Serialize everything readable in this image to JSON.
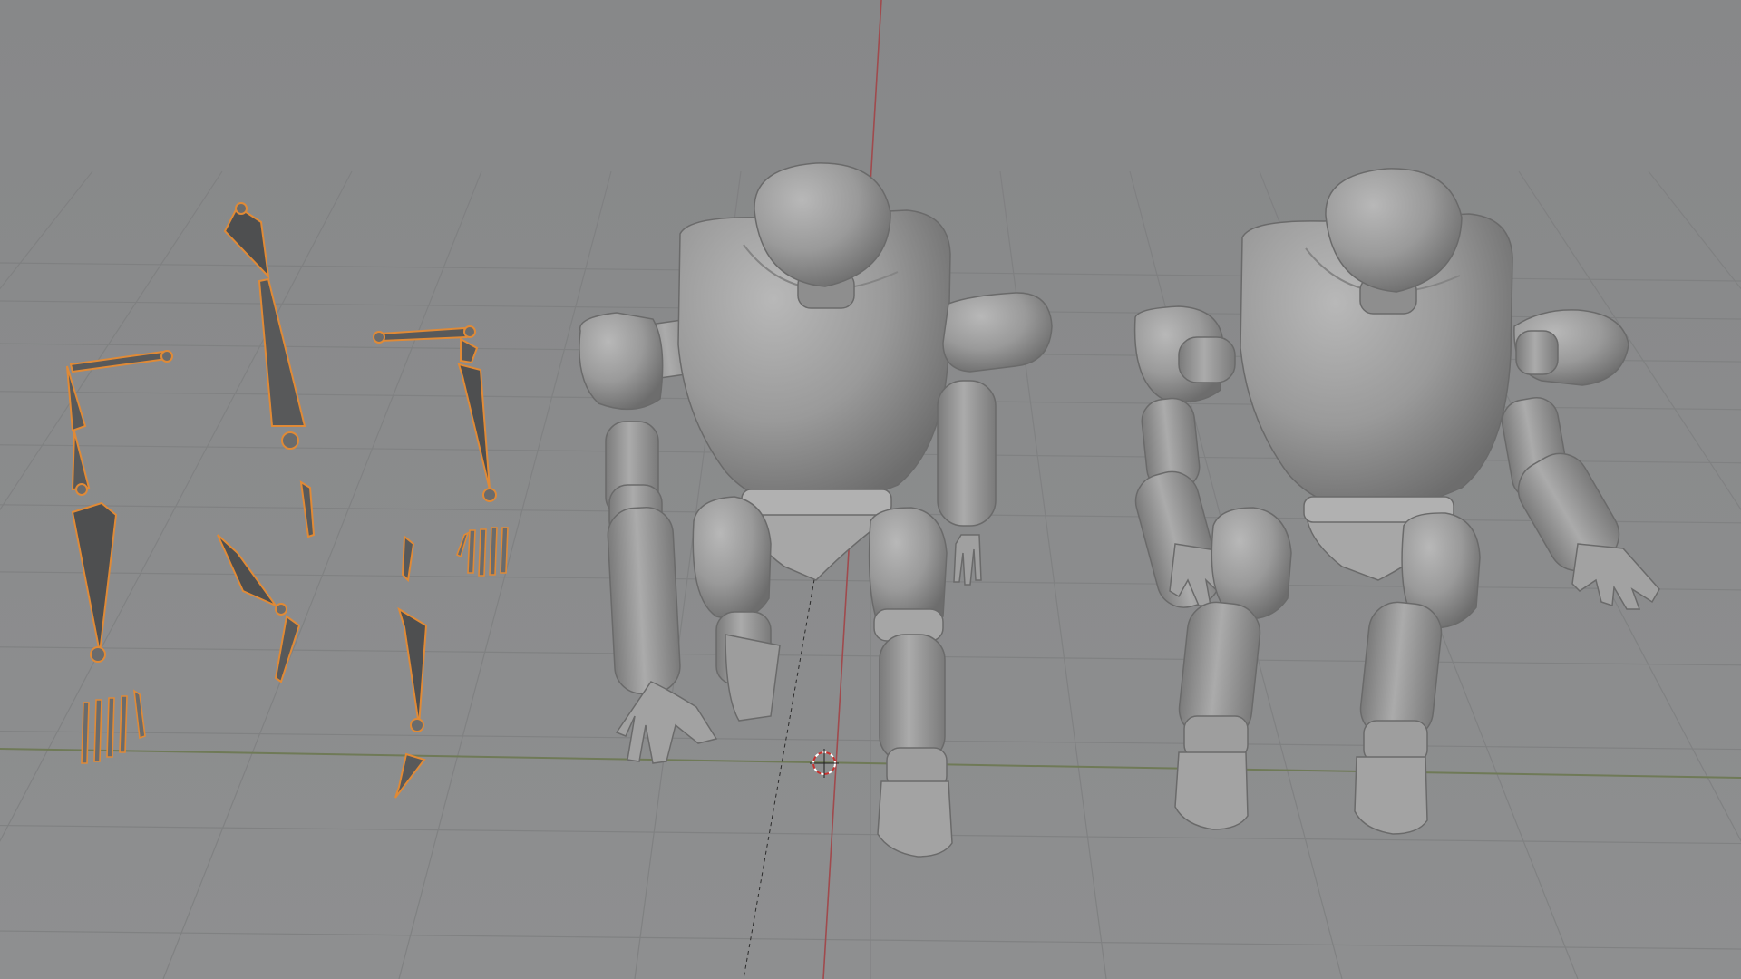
{
  "viewport": {
    "background": "#8a8b8c",
    "grid_color": "#7d7e7f",
    "x_axis_color": "#7a8a52",
    "y_axis_color": "#a3464a",
    "armature_outline_color": "#e08a36",
    "armature_fill_color": "#555657",
    "mesh_color": "#9c9c9c"
  },
  "objects": [
    {
      "kind": "armature",
      "name_icon": "armature-bones-icon"
    },
    {
      "kind": "mesh",
      "name_icon": "robot-mesh-icon"
    },
    {
      "kind": "mesh",
      "name_icon": "robot-mesh-icon"
    },
    {
      "kind": "cursor",
      "name_icon": "3d-cursor-icon"
    }
  ]
}
